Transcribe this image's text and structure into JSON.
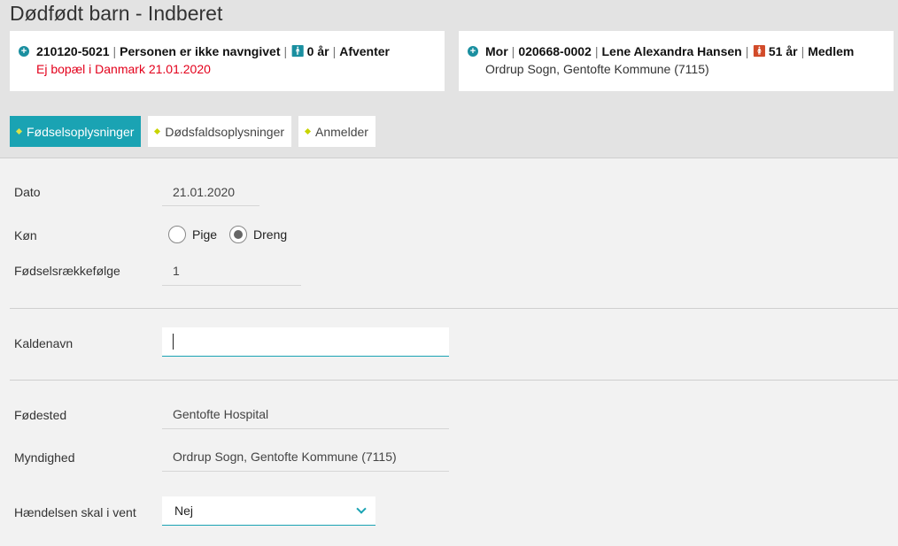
{
  "page": {
    "title": "Dødfødt barn - Indberet"
  },
  "child_card": {
    "cpr": "210120-5021",
    "name": "Personen er ikke navngivet",
    "age": "0 år",
    "status": "Afventer",
    "note": "Ej bopæl i Danmark 21.01.2020",
    "gender_icon": "male-person-icon"
  },
  "mother_card": {
    "role": "Mor",
    "cpr": "020668-0002",
    "name": "Lene Alexandra Hansen",
    "age": "51 år",
    "status": "Medlem",
    "parish": "Ordrup Sogn, Gentofte Kommune (7115)",
    "gender_icon": "female-person-icon"
  },
  "tabs": [
    {
      "label": "Fødselsoplysninger",
      "active": true
    },
    {
      "label": "Dødsfaldsoplysninger",
      "active": false
    },
    {
      "label": "Anmelder",
      "active": false
    }
  ],
  "form": {
    "date": {
      "label": "Dato",
      "value": "21.01.2020"
    },
    "gender": {
      "label": "Køn",
      "options": [
        "Pige",
        "Dreng"
      ],
      "selected": "Dreng"
    },
    "birth_order": {
      "label": "Fødselsrækkefølge",
      "value": "1"
    },
    "nickname": {
      "label": "Kaldenavn",
      "value": ""
    },
    "birthplace": {
      "label": "Fødested",
      "value": "Gentofte Hospital"
    },
    "authority": {
      "label": "Myndighed",
      "value": "Ordrup Sogn, Gentofte Kommune (7115)"
    },
    "on_hold": {
      "label": "Hændelsen skal i vent",
      "value": "Nej"
    }
  },
  "colors": {
    "accent": "#1aa3b3",
    "alert": "#e3001b",
    "diamond": "#c8d400"
  }
}
